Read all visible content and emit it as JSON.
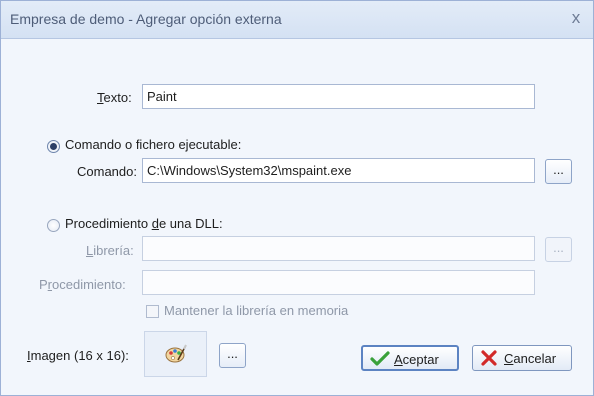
{
  "window": {
    "title": "Empresa de demo - Agregar opción externa",
    "close_label": "x"
  },
  "texto": {
    "label_accel": "T",
    "label_rest": "exto:",
    "value": "Paint"
  },
  "comando_option": {
    "label": "Comando o fichero ejecutable:",
    "selected": true,
    "field_label": "Comando:",
    "value": "C:\\Windows\\System32\\mspaint.exe",
    "browse_label": "..."
  },
  "dll_option": {
    "label_pre": "Procedimiento ",
    "label_accel": "d",
    "label_post": "e una DLL:",
    "selected": false,
    "libreria_accel": "L",
    "libreria_rest": "ibrería:",
    "libreria_value": "",
    "browse_label": "...",
    "procedimiento_pre": "P",
    "procedimiento_accel": "r",
    "procedimiento_post": "ocedimiento:",
    "procedimiento_value": "",
    "keep_in_memory_label": "Mantener la librería en memoria",
    "keep_in_memory_checked": false
  },
  "imagen": {
    "label_accel": "I",
    "label_rest": "magen (16 x 16):",
    "icon": "paint-palette-icon",
    "browse_label": "..."
  },
  "buttons": {
    "accept_accel": "A",
    "accept_rest": "ceptar",
    "cancel_accel": "C",
    "cancel_rest": "ancelar"
  },
  "colors": {
    "accent": "#5c83c2",
    "check_green": "#3aa13a",
    "cancel_red": "#d22a2a"
  }
}
